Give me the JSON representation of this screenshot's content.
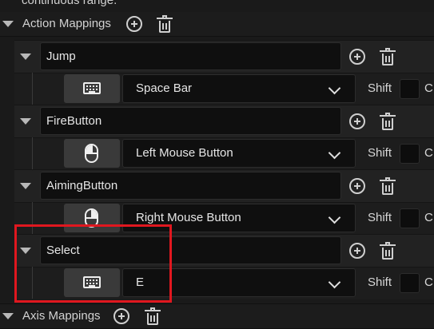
{
  "top_text": "continuous range.",
  "action_mappings": {
    "label": "Action Mappings",
    "items": [
      {
        "name": "Jump",
        "key": "Space Bar",
        "device_icon": "keyboard-icon",
        "modifiers": [
          "Shift",
          "C"
        ]
      },
      {
        "name": "FireButton",
        "key": "Left Mouse Button",
        "device_icon": "mouse-left-icon",
        "modifiers": [
          "Shift",
          "C"
        ]
      },
      {
        "name": "AimingButton",
        "key": "Right Mouse Button",
        "device_icon": "mouse-right-icon",
        "modifiers": [
          "Shift",
          "C"
        ]
      },
      {
        "name": "Select",
        "key": "E",
        "device_icon": "keyboard-icon",
        "modifiers": [
          "Shift",
          "C"
        ]
      }
    ]
  },
  "axis_mappings": {
    "label": "Axis Mappings"
  },
  "colors": {
    "highlight": "#e0171f",
    "background": "#1a1a1a",
    "field": "#0f0f0f"
  }
}
